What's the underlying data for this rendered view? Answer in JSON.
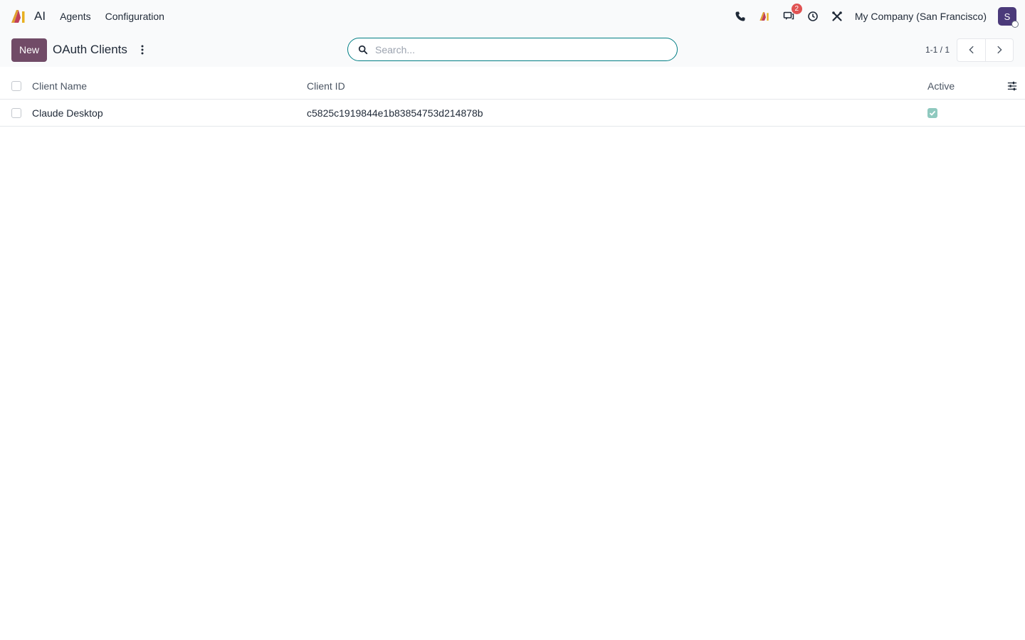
{
  "navbar": {
    "app_name": "AI",
    "menu": [
      {
        "label": "Agents"
      },
      {
        "label": "Configuration"
      }
    ],
    "messages_badge": "2",
    "company": "My Company (San Francisco)",
    "avatar_initial": "S"
  },
  "control_panel": {
    "new_label": "New",
    "title": "OAuth Clients",
    "search_placeholder": "Search...",
    "pager": "1-1 / 1"
  },
  "list": {
    "columns": {
      "client_name": "Client Name",
      "client_id": "Client ID",
      "active": "Active"
    },
    "rows": [
      {
        "client_name": "Claude Desktop",
        "client_id": "c5825c1919844e1b83854753d214878b",
        "active": true
      }
    ]
  },
  "colors": {
    "primary": "#714b67",
    "search_border": "#017e84",
    "badge": "#e05252",
    "active_check": "#8fc9bf",
    "avatar": "#4b3a7a"
  }
}
